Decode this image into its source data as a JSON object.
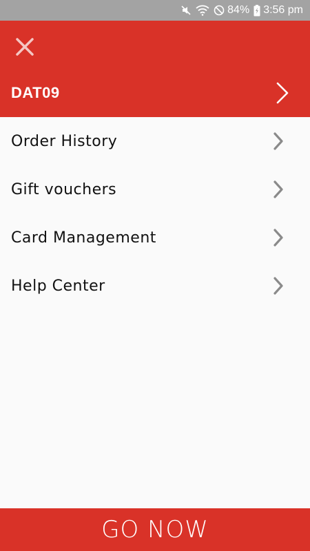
{
  "status_bar": {
    "battery": "84%",
    "time": "3:56 pm",
    "icons": [
      "mute-icon",
      "wifi-icon",
      "do-not-disturb-icon",
      "battery-charging-icon"
    ]
  },
  "header": {
    "close_icon": "close-icon",
    "account_name": "DAT09",
    "account_chevron": "chevron-right-icon"
  },
  "menu": {
    "items": [
      {
        "label": "Order History",
        "icon": "chevron-right-icon"
      },
      {
        "label": "Gift vouchers",
        "icon": "chevron-right-icon"
      },
      {
        "label": "Card Management",
        "icon": "chevron-right-icon"
      },
      {
        "label": "Help Center",
        "icon": "chevron-right-icon"
      }
    ]
  },
  "footer": {
    "label": "GO NOW"
  },
  "colors": {
    "brand_red": "#d93228",
    "status_bar": "#a3a3a3",
    "background": "#fafafa",
    "chevron_gray": "#8a8a8a"
  }
}
